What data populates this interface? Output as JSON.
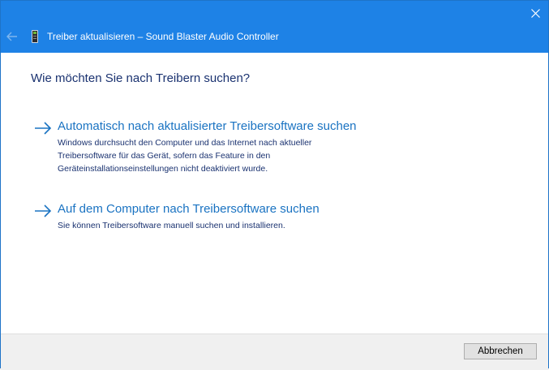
{
  "window": {
    "title": "Treiber aktualisieren – Sound Blaster Audio Controller"
  },
  "colors": {
    "titlebar": "#1e82e6",
    "heading": "#1a3270",
    "link": "#1a73c2"
  },
  "icons": {
    "back": "back-arrow-icon",
    "device": "audio-device-icon",
    "close": "close-icon",
    "option_arrow": "right-arrow-icon"
  },
  "main": {
    "heading": "Wie möchten Sie nach Treibern suchen?",
    "options": [
      {
        "title": "Automatisch nach aktualisierter Treibersoftware suchen",
        "description_lines": [
          "Windows durchsucht den Computer und das Internet nach aktueller",
          "Treibersoftware für das Gerät, sofern das Feature in den",
          "Geräteinstallationseinstellungen nicht deaktiviert wurde."
        ]
      },
      {
        "title": "Auf dem Computer nach Treibersoftware suchen",
        "description_lines": [
          "Sie können Treibersoftware manuell suchen und installieren."
        ]
      }
    ]
  },
  "footer": {
    "cancel_label": "Abbrechen"
  }
}
